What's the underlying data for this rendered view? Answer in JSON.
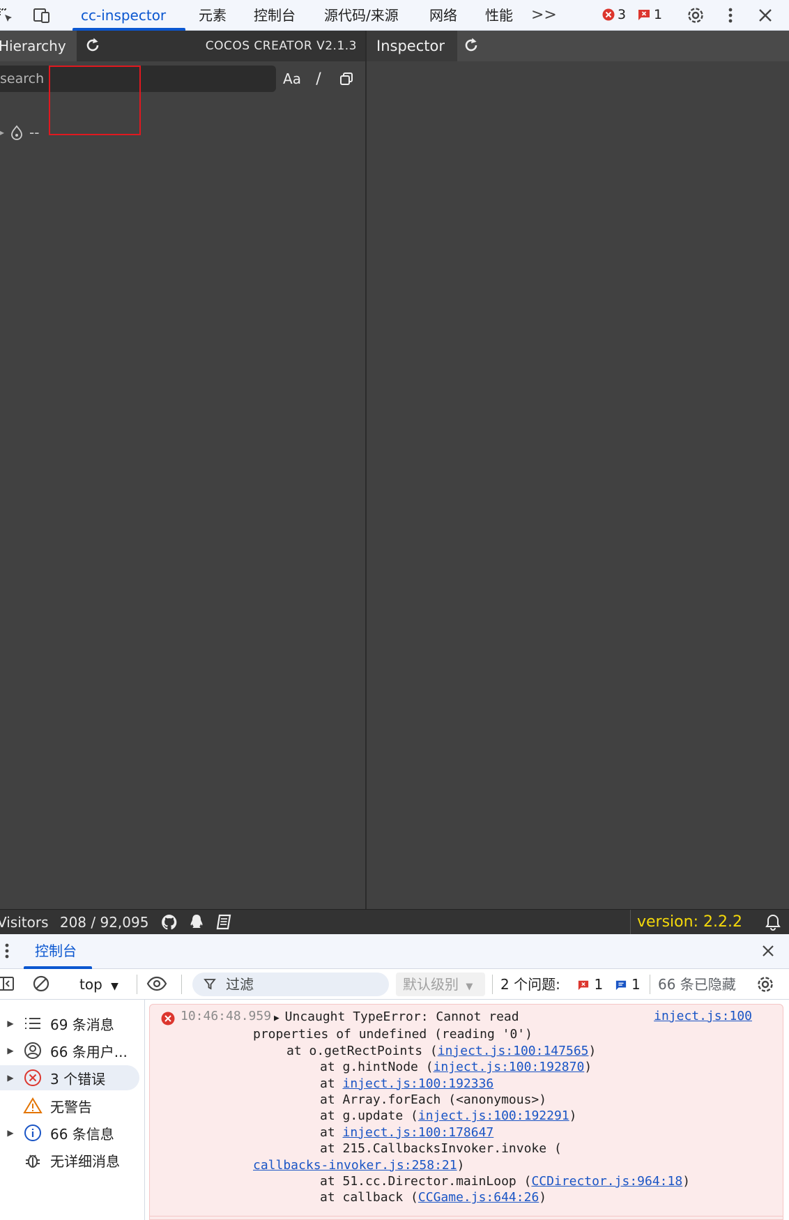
{
  "devtools": {
    "tabs": [
      {
        "label": "cc-inspector",
        "active": true
      },
      {
        "label": "元素"
      },
      {
        "label": "控制台"
      },
      {
        "label": "源代码/来源"
      },
      {
        "label": "网络"
      },
      {
        "label": "性能"
      }
    ],
    "more_label": ">>",
    "errors_count": "3",
    "issues_count": "1"
  },
  "hierarchy": {
    "tab_label": "Hierarchy",
    "engine_version": "COCOS CREATOR V2.1.3",
    "search_placeholder": "search",
    "case_label": "Aa",
    "regex_label": "/",
    "root_node": "--"
  },
  "inspector": {
    "tab_label": "Inspector"
  },
  "footer": {
    "visitors_label": "Visitors",
    "visitors_value": "208 / 92,095",
    "version": "version: 2.2.2"
  },
  "drawer": {
    "tab_label": "控制台",
    "context": "top",
    "filter_placeholder": "过滤",
    "level_label": "默认级别",
    "issues_label": "2 个问题:",
    "issues_error": "1",
    "issues_info": "1",
    "hidden_label": "66 条已隐藏"
  },
  "sidebar": {
    "items": [
      {
        "label": "69 条消息"
      },
      {
        "label": "66 条用户..."
      },
      {
        "label": "3 个错误"
      },
      {
        "label": "无警告"
      },
      {
        "label": "66 条信息"
      },
      {
        "label": "无详细消息"
      }
    ]
  },
  "log": {
    "time": "10:46:48.959",
    "source": "inject.js:100",
    "l1": "Uncaught TypeError: Cannot read",
    "l2": "properties of undefined (reading '0')",
    "l3a": "at o.getRectPoints (",
    "l3b": "inject.js:100:147565",
    "l3c": ")",
    "l4a": "at g.hintNode (",
    "l4b": "inject.js:100:192870",
    "l4c": ")",
    "l5a": "at ",
    "l5b": "inject.js:100:192336",
    "l6": "at Array.forEach (<anonymous>)",
    "l7a": "at g.update (",
    "l7b": "inject.js:100:192291",
    "l7c": ")",
    "l8a": "at ",
    "l8b": "inject.js:100:178647",
    "l9": "at 215.CallbacksInvoker.invoke (",
    "l10a": "callbacks-invoker.js:258:21",
    "l10b": ")",
    "l11a": "at 51.cc.Director.mainLoop (",
    "l11b": "CCDirector.js:964:18",
    "l11c": ")",
    "l12a": "at callback (",
    "l12b": "CCGame.js:644:26",
    "l12c": ")"
  },
  "colors": {
    "accent": "#0b57d0",
    "error": "#e0181f",
    "panel_bg": "#414141",
    "version_yellow": "#f5d90a"
  }
}
